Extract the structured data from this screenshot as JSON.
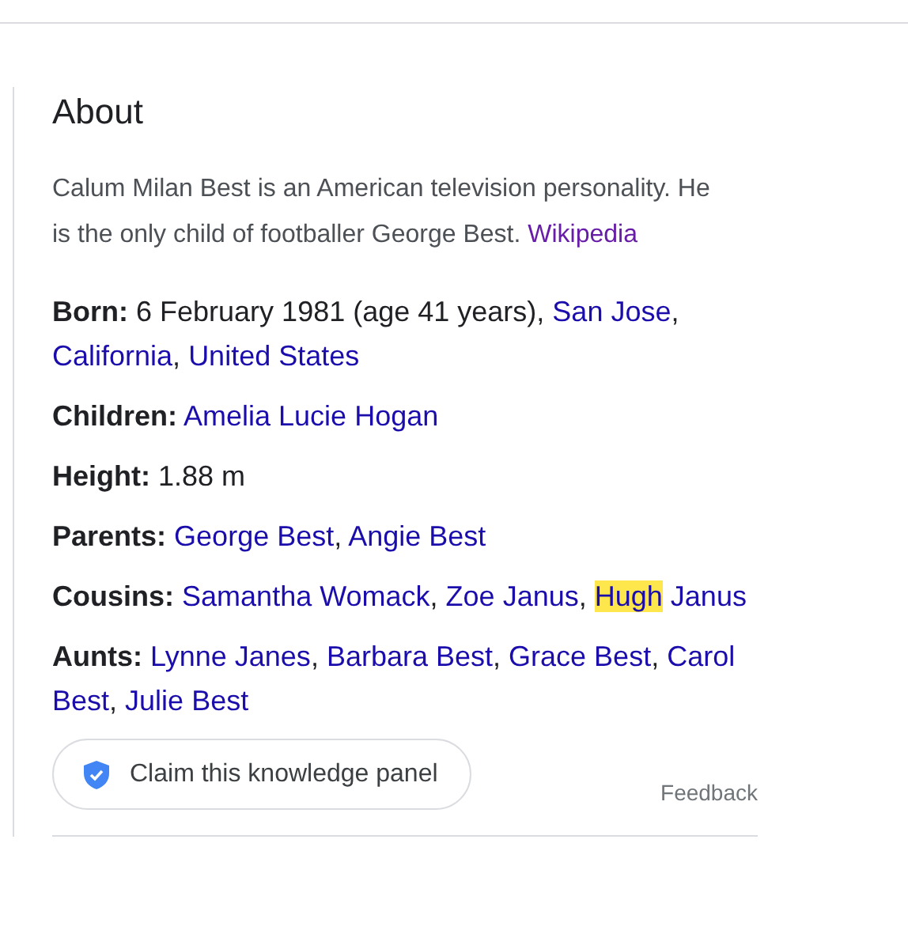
{
  "panel": {
    "title": "About",
    "description": {
      "text": "Calum Milan Best is an American television personality. He is the only child of footballer George Best.",
      "source": "Wikipedia"
    },
    "facts": [
      {
        "label": "Born:",
        "segments": [
          {
            "text": "6 February 1981 (age 41 years), ",
            "link": false,
            "highlighted": false
          },
          {
            "text": "San Jose",
            "link": true,
            "highlighted": false
          },
          {
            "text": ", ",
            "link": false,
            "highlighted": false
          },
          {
            "text": "California",
            "link": true,
            "highlighted": false
          },
          {
            "text": ", ",
            "link": false,
            "highlighted": false
          },
          {
            "text": "United States",
            "link": true,
            "highlighted": false
          }
        ]
      },
      {
        "label": "Children:",
        "segments": [
          {
            "text": "Amelia Lucie Hogan",
            "link": true,
            "highlighted": false
          }
        ]
      },
      {
        "label": "Height:",
        "segments": [
          {
            "text": "1.88 m",
            "link": false,
            "highlighted": false
          }
        ]
      },
      {
        "label": "Parents:",
        "segments": [
          {
            "text": "George Best",
            "link": true,
            "highlighted": false
          },
          {
            "text": ", ",
            "link": false,
            "highlighted": false
          },
          {
            "text": "Angie Best",
            "link": true,
            "highlighted": false
          }
        ]
      },
      {
        "label": "Cousins:",
        "segments": [
          {
            "text": "Samantha Womack",
            "link": true,
            "highlighted": false
          },
          {
            "text": ", ",
            "link": false,
            "highlighted": false
          },
          {
            "text": "Zoe Janus",
            "link": true,
            "highlighted": false
          },
          {
            "text": ", ",
            "link": false,
            "highlighted": false
          },
          {
            "text": "Hugh",
            "link": true,
            "highlighted": true
          },
          {
            "text": "Janus",
            "link": true,
            "highlighted": false
          }
        ]
      },
      {
        "label": "Aunts:",
        "segments": [
          {
            "text": "Lynne Janes",
            "link": true,
            "highlighted": false
          },
          {
            "text": ", ",
            "link": false,
            "highlighted": false
          },
          {
            "text": "Barbara Best",
            "link": true,
            "highlighted": false
          },
          {
            "text": ", ",
            "link": false,
            "highlighted": false
          },
          {
            "text": "Grace Best",
            "link": true,
            "highlighted": false
          },
          {
            "text": ", ",
            "link": false,
            "highlighted": false
          },
          {
            "text": "Carol",
            "link": true,
            "highlighted": false
          },
          {
            "text": "Best",
            "link": true,
            "highlighted": false
          },
          {
            "text": ", ",
            "link": false,
            "highlighted": false
          },
          {
            "text": "Julie Best",
            "link": true,
            "highlighted": false
          }
        ]
      }
    ],
    "claim_button": "Claim this knowledge panel",
    "feedback": "Feedback"
  }
}
